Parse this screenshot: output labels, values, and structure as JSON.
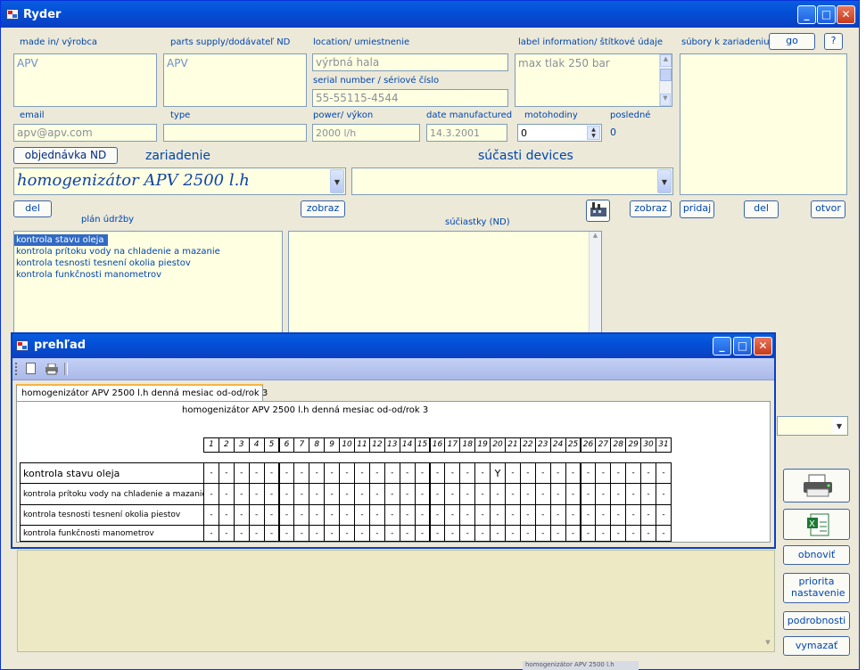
{
  "app": {
    "title": "Ryder"
  },
  "labels": {
    "made_in": "made in/ výrobca",
    "parts_supply": "parts supply/dodávateľ ND",
    "location": "location/ umiestnenie",
    "serial": "serial number / sériové číslo",
    "label_info": "label information/ štítkové údaje",
    "subory": "súbory k zariadeniu",
    "email": "email",
    "type": "type",
    "power": "power/ výkon",
    "date_manufactured": "date manufactured",
    "motohodiny": "motohodiny",
    "posledne": "posledné",
    "zariadenie": "zariadenie",
    "sucasti": "súčasti devices",
    "plan": "plán údržby",
    "suciastky": "súčiastky (ND)"
  },
  "values": {
    "made_in": "APV",
    "parts_supply": "APV",
    "location": "výrbná hala",
    "serial": "55-55115-4544",
    "label_info": "max tlak 250 bar",
    "email": "apv@apv.com",
    "type": "",
    "power": "2000 l/h",
    "date_manufactured": "14.3.2001",
    "motohodiny": "0",
    "posledne": "0",
    "zariadenie": "homogenizátor APV 2500 l.h",
    "sucasti": ""
  },
  "buttons": {
    "go": "go",
    "help": "?",
    "objednavka": "objednávka ND",
    "del": "del",
    "zobraz": "zobraz",
    "pridaj": "pridaj",
    "otvor": "otvor",
    "obnovit": "obnoviť",
    "priorita": "priorita nastavenie",
    "podrobnosti": "podrobnosti",
    "vymazat": "vymazať"
  },
  "plan_items": [
    "kontrola stavu oleja",
    "kontrola prítoku vody na chladenie a mazanie",
    "kontrola tesnosti tesnení okolia piestov",
    "kontrola funkčnosti manometrov"
  ],
  "overview": {
    "title": "prehľad",
    "tab": "homogenizátor APV 2500 l.h denná mesiac od-od/rok 3",
    "heading": "homogenizátor APV 2500 l.h denná mesiac od-od/rok 3",
    "days": [
      "1",
      "2",
      "3",
      "4",
      "5",
      "6",
      "7",
      "8",
      "9",
      "10",
      "11",
      "12",
      "13",
      "14",
      "15",
      "16",
      "17",
      "18",
      "19",
      "20",
      "21",
      "22",
      "23",
      "24",
      "25",
      "26",
      "27",
      "28",
      "29",
      "30",
      "31"
    ],
    "rows": [
      {
        "label": "kontrola stavu oleja",
        "marks": {
          "20": "Y"
        }
      },
      {
        "label": "kontrola prítoku vody na chladenie a mazanie",
        "marks": {}
      },
      {
        "label": "kontrola tesnosti tesnení okolia piestov",
        "marks": {}
      },
      {
        "label": "kontrola funkčnosti manometrov",
        "marks": {}
      }
    ],
    "empty_mark": "-"
  },
  "taskbar_hint": "homogenizátor APV 2500 l.h",
  "colors": {
    "accent": "#0045b0",
    "field_bg": "#ffffe1",
    "title_bar": "#0a5ddf"
  }
}
